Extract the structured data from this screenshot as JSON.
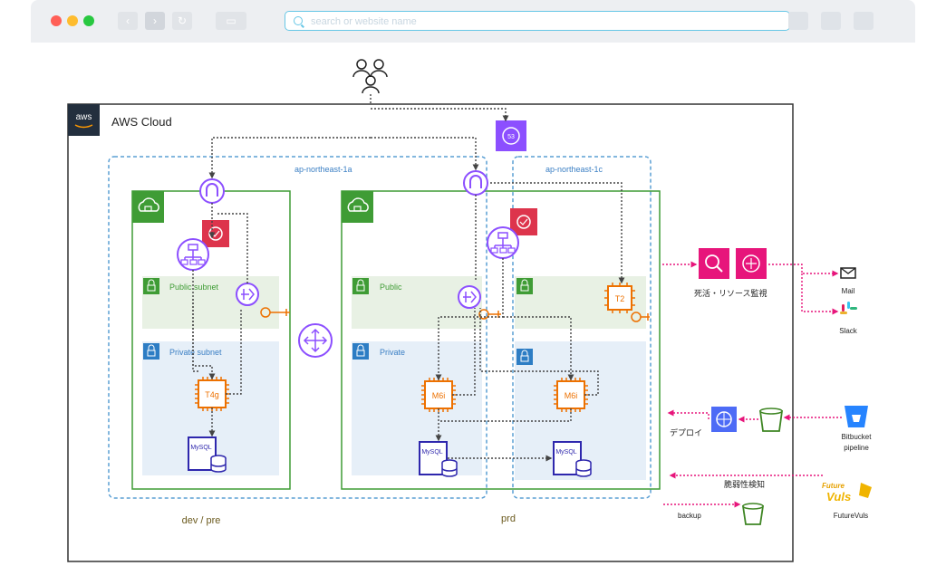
{
  "browser": {
    "address_placeholder": "search or website name",
    "dot_colors": [
      "#ff5f57",
      "#febc2e",
      "#28c840"
    ]
  },
  "diagram": {
    "cloud_title": "AWS Cloud",
    "aws_logo_text": "aws",
    "az_left": "ap-northeast-1a",
    "az_right": "ap-northeast-1c",
    "public_subnet_dev": "Public subnet",
    "private_subnet_dev": "Private subnet",
    "public_prd": "Public",
    "private_prd": "Private",
    "env_dev": "dev / pre",
    "env_prd": "prd",
    "instance_dev": "T4g",
    "instance_prd_a": "M6i",
    "instance_prd_c": "M6i",
    "instance_monitor": "T2",
    "db_label": "MySQL",
    "monitoring_label": "死活・リソース監視",
    "deploy_label": "デプロイ",
    "vuln_label": "脆弱性検知",
    "backup_label": "backup",
    "mail_label": "Mail",
    "slack_label": "Slack",
    "bitbucket_label_1": "Bitbucket",
    "bitbucket_label_2": "pipeline",
    "futurevuls_label": "FutureVuls",
    "futurevuls_logo_1": "Future",
    "futurevuls_logo_2": "Vuls"
  },
  "colors": {
    "vpc_green": "#3f9c35",
    "az_blue": "#5a9fd4",
    "public_bg": "#e8f1e4",
    "private_bg": "#e6eff8",
    "purple": "#8c4fff",
    "red": "#dd344c",
    "orange": "#ed7100",
    "pink": "#e7157b",
    "bucket_green": "#3f8624",
    "slack": [
      "#e01e5a",
      "#36c5f0",
      "#2eb67d",
      "#ecb22e"
    ]
  }
}
